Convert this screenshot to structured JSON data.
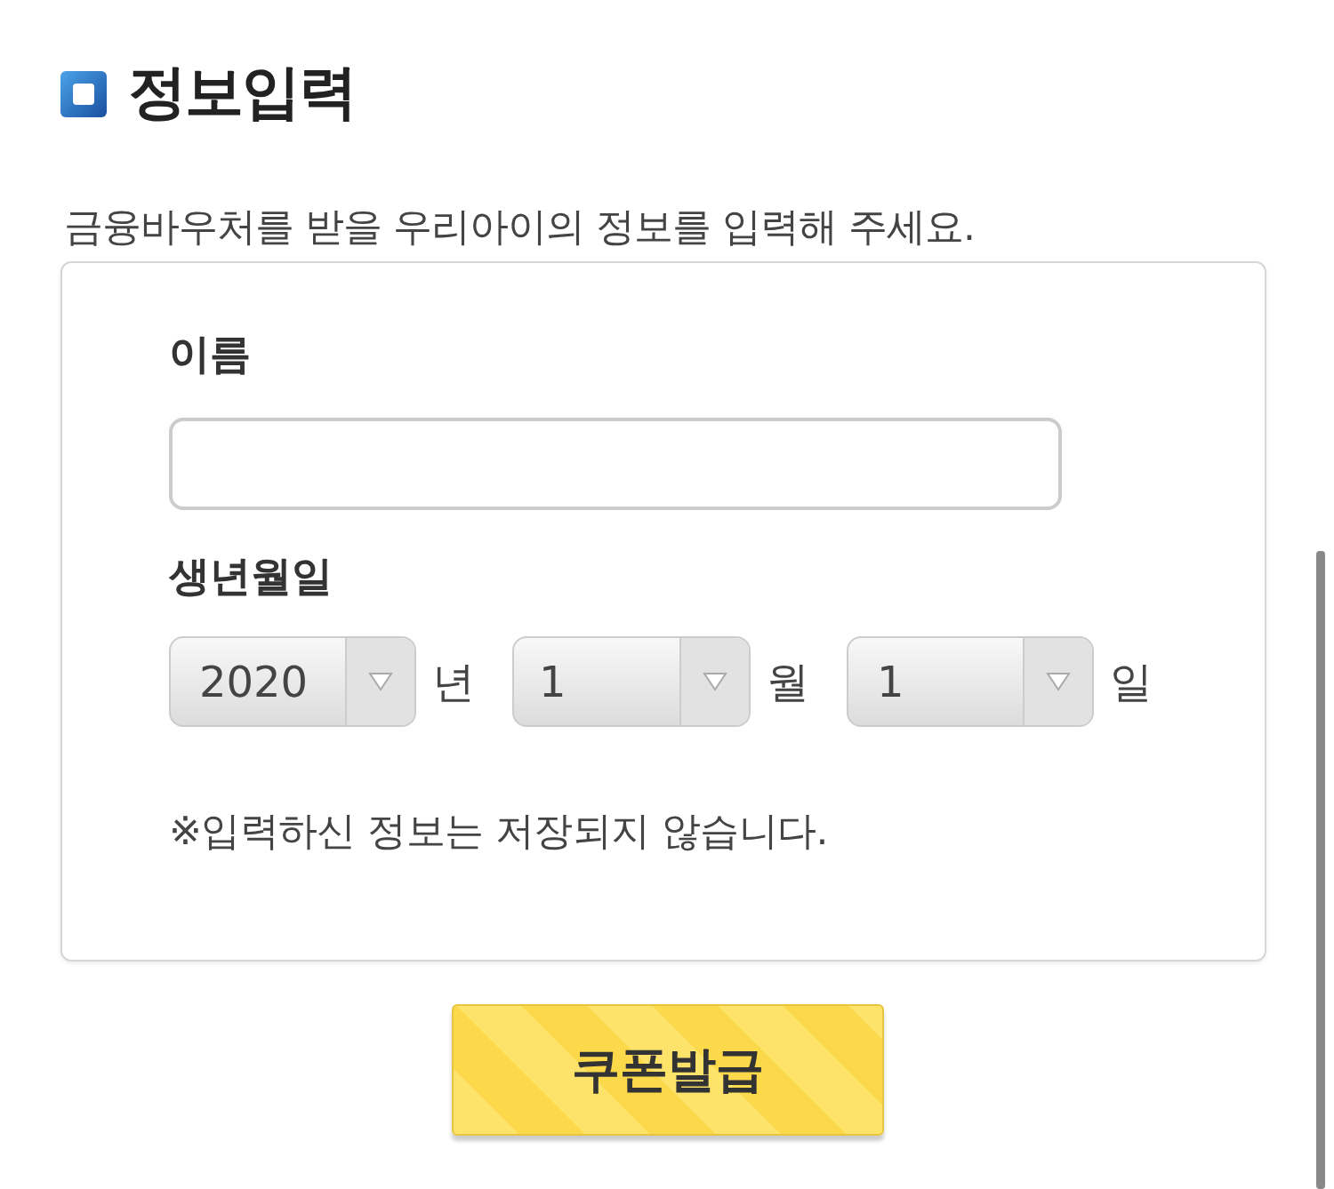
{
  "title": "정보입력",
  "subtitle": "금융바우처를 받을 우리아이의 정보를 입력해 주세요.",
  "name_field": {
    "label": "이름"
  },
  "birthdate": {
    "label": "생년월일",
    "selects": [
      {
        "value": "2020",
        "unit": "년"
      },
      {
        "value": "1",
        "unit": "월"
      },
      {
        "value": "1",
        "unit": "일"
      }
    ]
  },
  "notice": "※입력하신 정보는 저장되지 않습니다.",
  "submit_button": "쿠폰발급"
}
